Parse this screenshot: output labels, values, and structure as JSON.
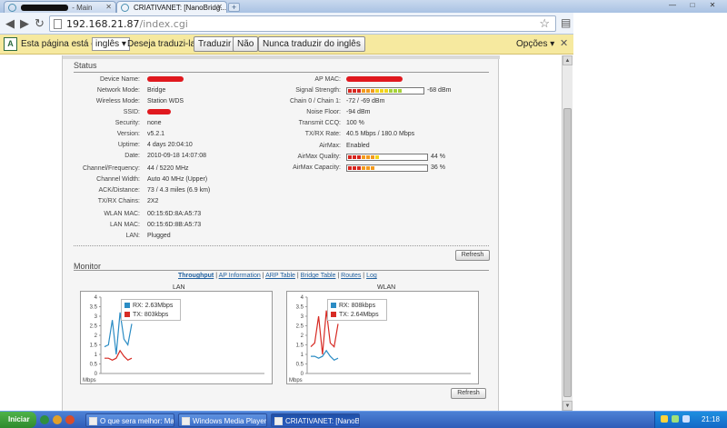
{
  "browser": {
    "tabs": [
      {
        "label": "- Main"
      },
      {
        "label": "CRIATIVANET: [NanoBridg..."
      }
    ],
    "new_tab": "+",
    "window_buttons": [
      "—",
      "□",
      "✕"
    ],
    "address": {
      "host": "192.168.21.87",
      "path": "/index.cgi"
    }
  },
  "translate_bar": {
    "prefix": "Esta página está em",
    "language": "inglês",
    "question": "Deseja traduzi-la?",
    "translate_btn": "Traduzir",
    "no_btn": "Não",
    "never_btn": "Nunca traduzir do inglês",
    "options": "Opções",
    "close": "✕"
  },
  "status": {
    "title": "Status",
    "left": [
      {
        "label": "Device Name:",
        "value": ""
      },
      {
        "label": "Network Mode:",
        "value": "Bridge"
      },
      {
        "label": "Wireless Mode:",
        "value": "Station WDS"
      },
      {
        "label": "SSID:",
        "value": ""
      },
      {
        "label": "Security:",
        "value": "none"
      },
      {
        "label": "Version:",
        "value": "v5.2.1"
      },
      {
        "label": "Uptime:",
        "value": "4 days 20:04:10"
      },
      {
        "label": "Date:",
        "value": "2010-09-18 14:07:08"
      },
      {
        "label": "Channel/Frequency:",
        "value": "44 / 5220 MHz"
      },
      {
        "label": "Channel Width:",
        "value": "Auto 40 MHz (Upper)"
      },
      {
        "label": "ACK/Distance:",
        "value": "73 / 4.3 miles (6.9 km)"
      },
      {
        "label": "TX/RX Chains:",
        "value": "2X2"
      },
      {
        "label": "WLAN MAC:",
        "value": "00:15:6D:8A:A5:73"
      },
      {
        "label": "LAN MAC:",
        "value": "00:15:6D:8B:A5:73"
      },
      {
        "label": "LAN:",
        "value": "Plugged"
      }
    ],
    "right": [
      {
        "label": "AP MAC:",
        "value": ""
      },
      {
        "label": "Signal Strength:",
        "value": "-68 dBm"
      },
      {
        "label": "Chain 0 / Chain 1:",
        "value": "-72 / -69 dBm"
      },
      {
        "label": "Noise Floor:",
        "value": "-94 dBm"
      },
      {
        "label": "Transmit CCQ:",
        "value": "100 %"
      },
      {
        "label": "TX/RX Rate:",
        "value": "40.5 Mbps / 180.0 Mbps"
      },
      {
        "label": "AirMax:",
        "value": "Enabled"
      },
      {
        "label": "AirMax Quality:",
        "value": "44 %"
      },
      {
        "label": "AirMax Capacity:",
        "value": "36 %"
      }
    ],
    "signal_level": 0.78,
    "airmax_quality": 0.44,
    "airmax_capacity": 0.36,
    "refresh": "Refresh"
  },
  "monitor": {
    "title": "Monitor",
    "links": [
      "Throughput",
      "AP Information",
      "ARP Table",
      "Bridge Table",
      "Routes",
      "Log"
    ],
    "refresh": "Refresh"
  },
  "chart_data": [
    {
      "type": "line",
      "title": "LAN",
      "ylabel": "Mbps",
      "ylim": [
        0,
        4
      ],
      "yticks": [
        "4",
        "3.5",
        "3",
        "2.5",
        "2",
        "1.5",
        "1",
        "0.5",
        "0"
      ],
      "series": [
        {
          "name": "RX: 2.63Mbps",
          "color": "#2b8cc4",
          "values": [
            1.4,
            1.5,
            2.8,
            1.0,
            3.2,
            1.8,
            1.5,
            2.6
          ]
        },
        {
          "name": "TX: 803kbps",
          "color": "#d72b24",
          "values": [
            0.8,
            0.8,
            0.7,
            0.8,
            1.2,
            0.9,
            0.7,
            0.8
          ]
        }
      ]
    },
    {
      "type": "line",
      "title": "WLAN",
      "ylabel": "Mbps",
      "ylim": [
        0,
        4
      ],
      "yticks": [
        "4",
        "3.5",
        "3",
        "2.5",
        "2",
        "1.5",
        "1",
        "0.5",
        "0"
      ],
      "series": [
        {
          "name": "RX: 808kbps",
          "color": "#2b8cc4",
          "values": [
            0.9,
            0.9,
            0.8,
            0.9,
            1.2,
            0.9,
            0.7,
            0.8
          ]
        },
        {
          "name": "TX: 2.64Mbps",
          "color": "#d72b24",
          "values": [
            1.4,
            1.6,
            3.0,
            1.0,
            3.3,
            1.6,
            1.4,
            2.6
          ]
        }
      ]
    }
  ],
  "taskbar": {
    "start": "Iniciar",
    "tasks": [
      {
        "label": "O que sera melhor: Man..."
      },
      {
        "label": "Windows Media Player"
      },
      {
        "label": "CRIATIVANET: [NanoB..."
      }
    ],
    "clock": "21:18"
  }
}
